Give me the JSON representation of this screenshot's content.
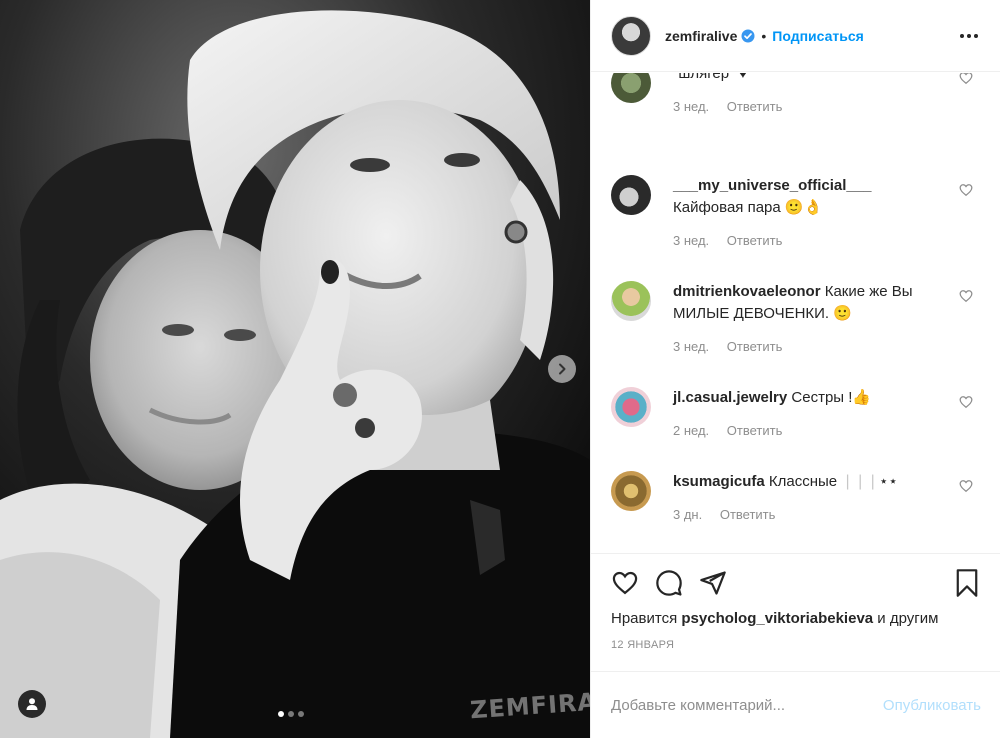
{
  "header": {
    "username": "zemfiralive",
    "separator": "•",
    "follow_label": "Подписаться"
  },
  "comments": [
    {
      "user": "",
      "text": "\"шлягер\" ♥",
      "time": "3 нед.",
      "reply": "Ответить"
    },
    {
      "user": "___my_universe_official___",
      "text": "Кайфовая пара 🙂👌",
      "time": "3 нед.",
      "reply": "Ответить"
    },
    {
      "user": "dmitrienkovaeleonor",
      "text": "Какие же Вы МИЛЫЕ ДЕВОЧЕНКИ. 🙂",
      "time": "3 нед.",
      "reply": "Ответить"
    },
    {
      "user": "jl.casual.jewelry",
      "text": "Сестры !👍",
      "time": "2 нед.",
      "reply": "Ответить"
    },
    {
      "user": "ksumagicufa",
      "text": "Классные",
      "text_muted": " ❘❘❘",
      "text_tail": "⋆⋆",
      "time": "3 дн.",
      "reply": "Ответить"
    }
  ],
  "likes": {
    "prefix": "Нравится",
    "user": "psycholog_viktoriabekieva",
    "suffix": "и другим"
  },
  "date": "12 ЯНВАРЯ",
  "add_comment": {
    "placeholder": "Добавьте комментарий...",
    "publish_label": "Опубликовать"
  },
  "photo": {
    "slide_total": 3,
    "slide_active": 1,
    "sweatshirt_text": "ZEMFIRA"
  },
  "icons": {
    "verified": "verified-badge-icon",
    "more": "more-options-icon",
    "like": "heart-icon",
    "comment": "comment-icon",
    "share": "paper-plane-icon",
    "save": "bookmark-icon",
    "next": "chevron-right-icon",
    "tag": "user-tag-icon"
  },
  "colors": {
    "link_blue": "#0095f6",
    "publish_disabled": "#b2dffc",
    "secondary_text": "#8e8e8e",
    "border": "#efefef"
  }
}
